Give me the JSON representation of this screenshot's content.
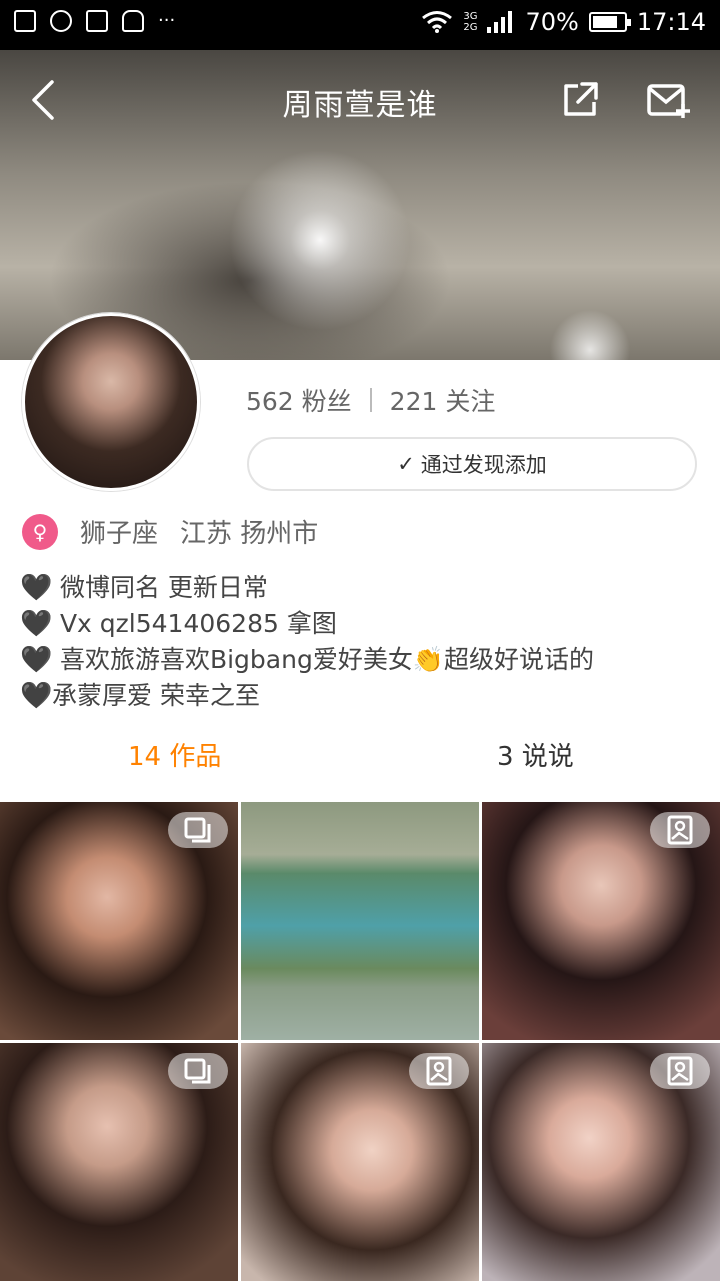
{
  "status_bar": {
    "network_top": "3G",
    "network_bottom": "2G",
    "battery": "70%",
    "time": "17:14",
    "more": "···"
  },
  "header": {
    "title": "周雨萱是谁"
  },
  "profile": {
    "fans": "562 粉丝",
    "following": "221 关注",
    "follow_button": "通过发现添加",
    "check_icon": "✓",
    "gender_icon": "♀",
    "zodiac": "狮子座",
    "location": "江苏 扬州市",
    "bio_lines": [
      "微博同名 更新日常",
      "Vx qzl541406285  拿图",
      "喜欢旅游喜欢Bigbang爱好美女👏超级好说话的",
      "承蒙厚爱 荣幸之至"
    ],
    "heart": "🖤"
  },
  "tabs": {
    "works": "14 作品",
    "talk": "3 说说"
  },
  "grid": {
    "badges": [
      "multi-image-icon",
      "none",
      "image-icon",
      "multi-image-icon",
      "image-icon",
      "image-icon"
    ]
  },
  "colors": {
    "accent": "#ff8200",
    "gender_badge": "#f05a8a"
  }
}
